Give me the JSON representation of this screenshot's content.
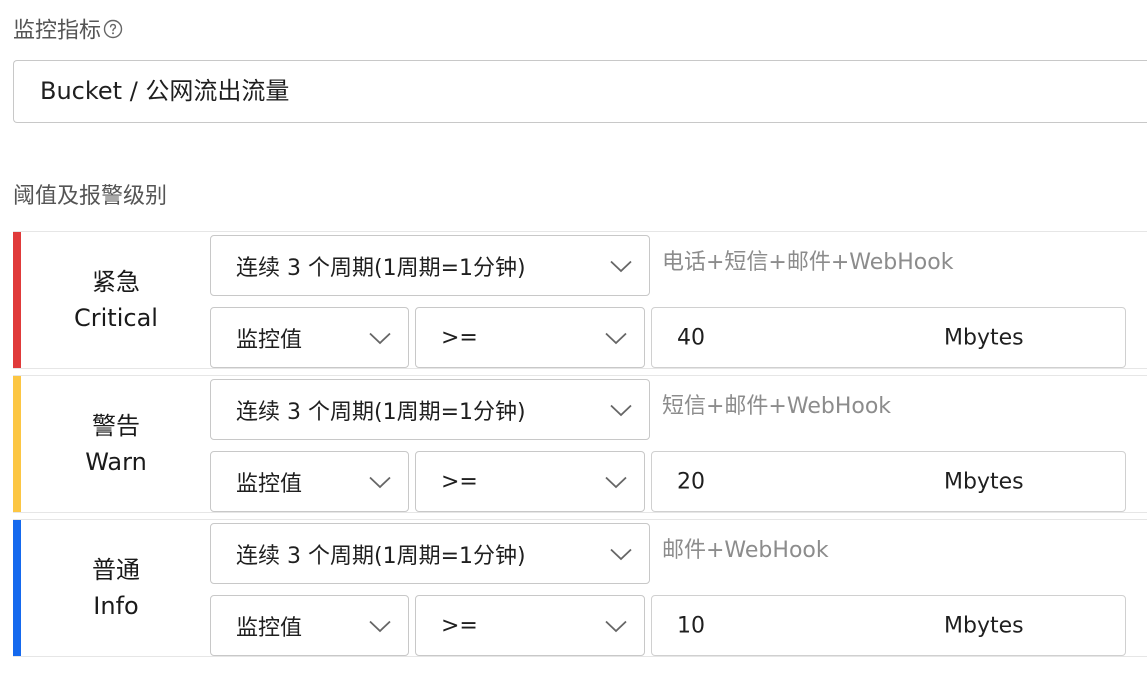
{
  "metric": {
    "label": "监控指标",
    "help_icon": "question-circle-icon",
    "value": "Bucket / 公网流出流量"
  },
  "thresholds": {
    "label": "阈值及报警级别",
    "levels": [
      {
        "name_cn": "紧急",
        "name_en": "Critical",
        "color": "#e03a3a",
        "period": "连续 3 个周期(1周期=1分钟)",
        "channels": "电话+短信+邮件+WebHook",
        "stat": "监控值",
        "operator": ">=",
        "value": "40",
        "unit": "Mbytes"
      },
      {
        "name_cn": "警告",
        "name_en": "Warn",
        "color": "#fcc643",
        "period": "连续 3 个周期(1周期=1分钟)",
        "channels": "短信+邮件+WebHook",
        "stat": "监控值",
        "operator": ">=",
        "value": "20",
        "unit": "Mbytes"
      },
      {
        "name_cn": "普通",
        "name_en": "Info",
        "color": "#1569ee",
        "period": "连续 3 个周期(1周期=1分钟)",
        "channels": "邮件+WebHook",
        "stat": "监控值",
        "operator": ">=",
        "value": "10",
        "unit": "Mbytes"
      }
    ]
  }
}
